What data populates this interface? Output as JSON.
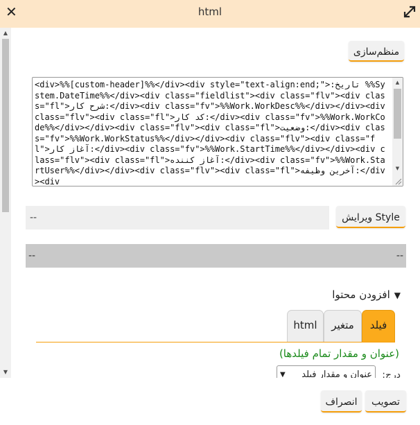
{
  "window": {
    "title": "html",
    "close_glyph": "✕",
    "expand_icon": "expand-icon"
  },
  "toolbar": {
    "format_label": "منظم‌سازی"
  },
  "code_editor": {
    "value": "<div>%%[custom-header]%%</div><div style=\"text-align:end;\">:تاریخ %%System.DateTime%%</div><div class=\"fieldlist\"><div class=\"flv\"><div class=\"fl\">شرح کار:</div><div class=\"fv\">%%Work.WorkDesc%%</div></div><div class=\"flv\"><div class=\"fl\">کد کار:</div><div class=\"fv\">%%Work.WorkCode%%</div></div><div class=\"flv\"><div class=\"fl\">وضعیت:</div><div class=\"fv\">%%Work.WorkStatus%%</div></div><div class=\"flv\"><div class=\"fl\">آغاز کار:</div><div class=\"fv\">%%Work.StartTime%%</div></div><div class=\"flv\"><div class=\"fl\">آغاز کننده:</div><div class=\"fv\">%%Work.StartUser%%</div></div><div class=\"flv\"><div class=\"fl\">آخرین وظیفه:</div><div"
  },
  "style_row": {
    "input_value": "--",
    "button_label": "ویرایش Style"
  },
  "gray_bar": {
    "left_text": "--",
    "right_text": "--"
  },
  "add_content": {
    "label": "افزودن محتوا",
    "toggle_glyph": "▼"
  },
  "tabs": [
    {
      "label": "فیلد",
      "active": true
    },
    {
      "label": "متغیر",
      "active": false
    },
    {
      "label": "html",
      "active": false
    }
  ],
  "field_panel": {
    "hint": "(عنوان و مقدار تمام فیلدها)",
    "insert_label": "درج:",
    "insert_selected": "عنوان و مقدار فیلد"
  },
  "footer": {
    "approve_label": "تصویب",
    "cancel_label": "انصراف"
  },
  "colors": {
    "titlebar": "#fde6c8",
    "accent": "#f59e0b",
    "active_tab": "#fbab1c",
    "hint_green": "#1a8a1a"
  }
}
